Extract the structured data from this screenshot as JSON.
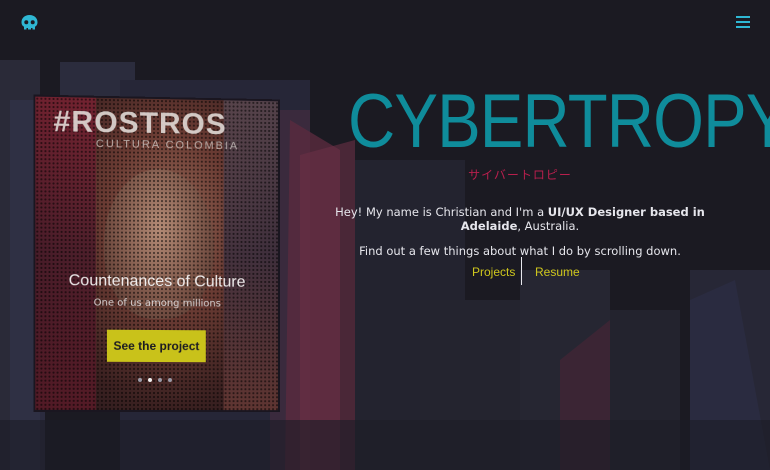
{
  "header": {
    "logo_icon": "skull-logo-icon",
    "menu_icon": "hamburger-menu-icon"
  },
  "billboard": {
    "title_big": "#ROSTROS",
    "title_small": "CULTURA COLOMBIA",
    "heading": "Countenances of Culture",
    "subheading": "One of us among millions",
    "button_label": "See the project",
    "dots": [
      {
        "active": false
      },
      {
        "active": true
      },
      {
        "active": false
      },
      {
        "active": false
      }
    ]
  },
  "hero": {
    "title": "CYBERTROPY",
    "subtitle_jp": "サイバートロピー",
    "intro_pre": "Hey! My name is Christian and I'm a ",
    "intro_bold": "UI/UX Designer based in Adelaide",
    "intro_post": ", Australia.",
    "intro_line2": "Find out a few things about what I do by scrolling down.",
    "links": {
      "projects": "Projects",
      "resume": "Resume"
    }
  },
  "colors": {
    "accent": "#0f8c9b",
    "jp_red": "#b81f4d",
    "link_yellow": "#cfc71d",
    "button_yellow": "#c9c21a",
    "background": "#1b1a22"
  }
}
